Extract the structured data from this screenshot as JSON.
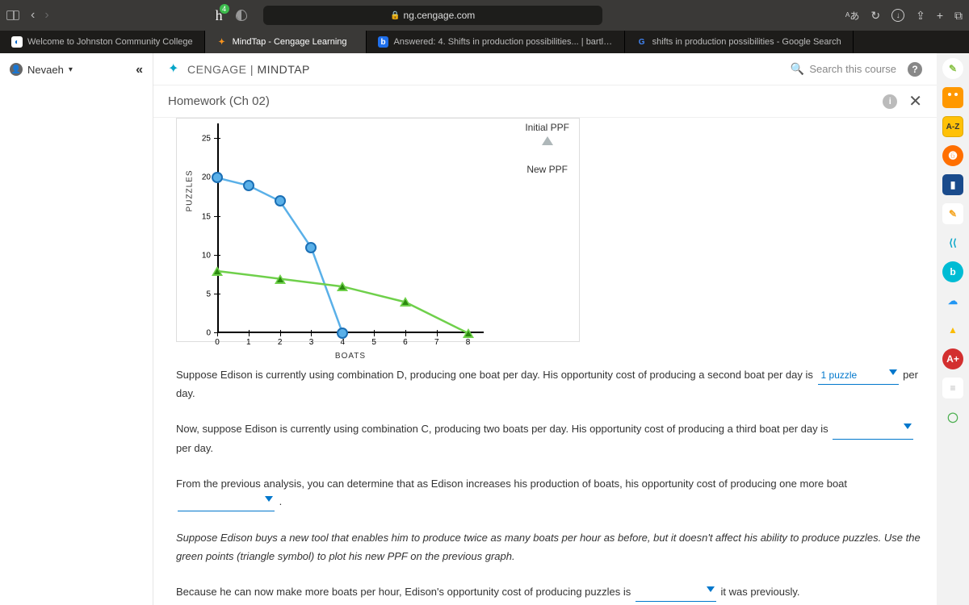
{
  "browser": {
    "badge_count": "4",
    "url": "ng.cengage.com",
    "tabs": [
      {
        "label": "Welcome to Johnston Community College",
        "fav_bg": "#fff",
        "fav_fg": "#06c",
        "fav": "◐"
      },
      {
        "label": "MindTap - Cengage Learning",
        "fav_bg": "transparent",
        "fav_fg": "#f7931e",
        "fav": "✦",
        "active": true
      },
      {
        "label": "Answered: 4. Shifts in production possibilities... | bartle...",
        "fav_bg": "#1f6feb",
        "fav_fg": "#fff",
        "fav": "b"
      },
      {
        "label": "shifts in production possibilities - Google Search",
        "fav_bg": "transparent",
        "fav_fg": "#4285f4",
        "fav": "G"
      }
    ]
  },
  "user_name": "Nevaeh",
  "brand_a": "CENGAGE",
  "brand_b": "MINDTAP",
  "search_placeholder": "Search this course",
  "homework_title": "Homework (Ch 02)",
  "chart_data": {
    "type": "line",
    "xlabel": "BOATS",
    "ylabel": "PUZZLES",
    "x_ticks": [
      0,
      1,
      2,
      3,
      4,
      5,
      6,
      7,
      8
    ],
    "y_ticks": [
      0,
      5,
      10,
      15,
      20,
      25
    ],
    "xlim": [
      0,
      8.5
    ],
    "ylim": [
      0,
      27
    ],
    "series": [
      {
        "name": "Initial PPF",
        "symbol": "circle",
        "color": "#5ab0e8",
        "points": [
          [
            0,
            20
          ],
          [
            1,
            19
          ],
          [
            2,
            17
          ],
          [
            3,
            11
          ],
          [
            4,
            0
          ]
        ]
      },
      {
        "name": "New PPF",
        "symbol": "triangle",
        "color": "#6fd04b",
        "points": [
          [
            0,
            8
          ],
          [
            2,
            7
          ],
          [
            4,
            6
          ],
          [
            6,
            4
          ],
          [
            8,
            0
          ]
        ]
      }
    ],
    "legend": [
      "Initial PPF",
      "New PPF"
    ]
  },
  "q1_a": "Suppose Edison is currently using combination D, producing one boat per day. His opportunity cost of producing a second boat per day is",
  "q1_drop": "1 puzzle",
  "q1_b": "per day.",
  "q2_a": "Now, suppose Edison is currently using combination C, producing two boats per day. His opportunity cost of producing a third boat per day is",
  "q2_b": "per day.",
  "q3_a": "From the previous analysis, you can determine that as Edison increases his production of boats, his opportunity cost of producing one more boat",
  "q3_b": ".",
  "q4": "Suppose Edison buys a new tool that enables him to produce twice as many boats per hour as before, but it doesn't affect his ability to produce puzzles. Use the green points (triangle symbol) to plot his new PPF on the previous graph.",
  "q5_a": "Because he can now make more boats per hour, Edison's opportunity cost of producing puzzles is",
  "q5_b": "it was previously.",
  "rail": [
    {
      "bg": "#fff",
      "fg": "#8bc34a",
      "txt": "✎",
      "round": true
    },
    {
      "bg": "#ff9800",
      "fg": "#fff",
      "txt": "�categories"
    },
    {
      "bg": "#ffc107",
      "fg": "#333",
      "txt": "A-Z"
    },
    {
      "bg": "#ff6f00",
      "fg": "#fff",
      "txt": "➏",
      "round": true
    },
    {
      "bg": "#1a4b8c",
      "fg": "#fff",
      "txt": "▮"
    },
    {
      "bg": "#fff",
      "fg": "#f5a623",
      "txt": "✎"
    },
    {
      "bg": "transparent",
      "fg": "#06a5c8",
      "txt": "⟨⟨"
    },
    {
      "bg": "#00bcd4",
      "fg": "#fff",
      "txt": "b",
      "round": true
    },
    {
      "bg": "transparent",
      "fg": "#2196f3",
      "txt": "☁"
    },
    {
      "bg": "transparent",
      "fg": "#fbbc04",
      "txt": "▲"
    },
    {
      "bg": "#d32f2f",
      "fg": "#fff",
      "txt": "A+",
      "round": true
    },
    {
      "bg": "#fff",
      "fg": "#bbb",
      "txt": "≡"
    },
    {
      "bg": "transparent",
      "fg": "#4caf50",
      "txt": "◯"
    }
  ]
}
